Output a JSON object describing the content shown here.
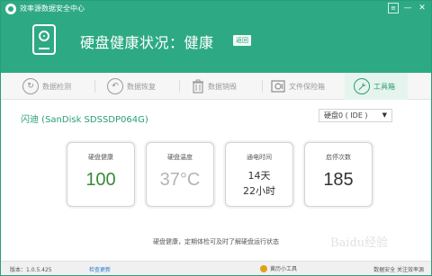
{
  "window": {
    "title": "效率源数据安全中心",
    "menu_icon": "menu-icon",
    "minimize_icon": "minimize-icon",
    "close_icon": "close-icon"
  },
  "header": {
    "status_title": "硬盘健康状况：健康",
    "back_label": "返回",
    "disk_icon": "disk-icon",
    "bg_color": "#2daa83"
  },
  "tabs": [
    {
      "label": "数据检测",
      "icon": "refresh-circle-icon"
    },
    {
      "label": "数据恢复",
      "icon": "undo-circle-icon"
    },
    {
      "label": "数据销毁",
      "icon": "trash-icon"
    },
    {
      "label": "文件保险箱",
      "icon": "safe-icon"
    },
    {
      "label": "工具箱",
      "icon": "wrench-icon",
      "active": true
    }
  ],
  "device": {
    "name": "闪迪 (SanDisk SDSSDP064G)",
    "selected_disk": "硬盘0 ( IDE )"
  },
  "cards": [
    {
      "label": "硬盘健康",
      "value": "100"
    },
    {
      "label": "硬盘温度",
      "value": "37°C"
    },
    {
      "label": "通电时间",
      "value_line1": "14天",
      "value_line2": "22小时"
    },
    {
      "label": "启停次数",
      "value": "185"
    }
  ],
  "hint": "硬盘健康，定期体检可及时了解硬盘运行状态",
  "footer": {
    "version": "版本：1.0.5.425",
    "update_link": "检查更新",
    "toolbox": "黄历小工具",
    "follow": "数据安全 关注效率源"
  },
  "watermark": "Baidu经验",
  "colors": {
    "accent": "#2daa83",
    "healthy_value": "#3a8a3a"
  }
}
